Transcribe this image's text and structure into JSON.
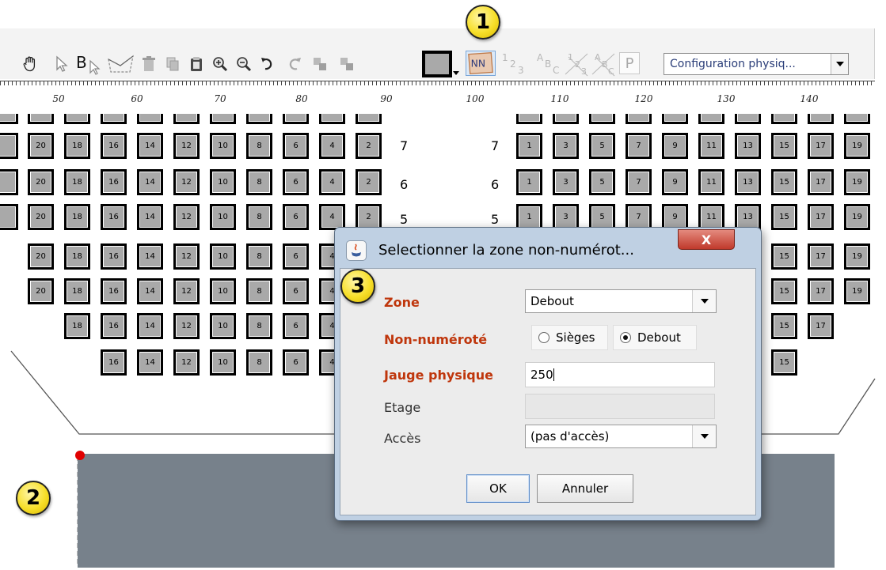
{
  "toolbar": {
    "tools": [
      "hand-icon",
      "pointer-icon",
      "bold-select-icon",
      "lasso-icon",
      "trash-icon",
      "copy-icon",
      "paste-icon",
      "zoom-in-icon",
      "zoom-out-icon",
      "undo-icon",
      "redo-icon",
      "align-left-icon",
      "align-right-icon",
      "seat-shape-icon"
    ],
    "nn_label": "NN",
    "abc_label": "ABC",
    "p_label": "P",
    "configuration_combo": "Configuration physiq..."
  },
  "ruler": {
    "labels": [
      "50",
      "60",
      "70",
      "80",
      "90",
      "100",
      "110",
      "120",
      "130",
      "140"
    ]
  },
  "seating": {
    "left_block_numbers": [
      "20",
      "18",
      "16",
      "14",
      "12",
      "10",
      "8",
      "6",
      "4",
      "2"
    ],
    "right_block_numbers": [
      "1",
      "3",
      "5",
      "7",
      "9",
      "11",
      "13",
      "15",
      "17",
      "19"
    ],
    "row_labels": [
      "7",
      "6",
      "5"
    ]
  },
  "callouts": {
    "one": "1",
    "two": "2",
    "three": "3"
  },
  "dialog": {
    "title": "Selectionner la zone non-numérot...",
    "close_label": "X",
    "zone_label": "Zone",
    "zone_value": "Debout",
    "non_numerote_label": "Non-numéroté",
    "radio_sieges": "Sièges",
    "radio_debout": "Debout",
    "radio_selected": "Debout",
    "jauge_label": "Jauge physique",
    "jauge_value": "250",
    "etage_label": "Etage",
    "etage_value": "",
    "acces_label": "Accès",
    "acces_value": "(pas d'accès)",
    "ok_label": "OK",
    "cancel_label": "Annuler"
  },
  "colors": {
    "required_label": "#bf360c",
    "seat_fill": "#a9a9a9",
    "standing_zone": "#77818b",
    "callout": "#f7df2a",
    "close_button": "#c0392b"
  }
}
